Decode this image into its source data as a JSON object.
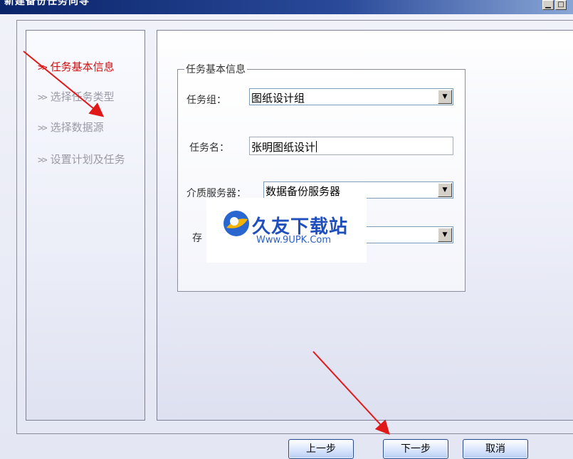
{
  "window": {
    "title": "新建备份任务向导",
    "minimize_symbol": "▁",
    "maximize_symbol": "□"
  },
  "steps": [
    {
      "chevron": ">>",
      "label": "任务基本信息",
      "active": true
    },
    {
      "chevron": ">>",
      "label": "选择任务类型",
      "active": false
    },
    {
      "chevron": ">>",
      "label": "选择数据源",
      "active": false
    },
    {
      "chevron": ">>",
      "label": "设置计划及任务",
      "active": false
    }
  ],
  "group": {
    "legend": "任务基本信息",
    "task_group": {
      "label": "任务组：",
      "value": "图纸设计组"
    },
    "task_name": {
      "label": "任务名：",
      "value": "张明图纸设计"
    },
    "media_server": {
      "label": "介质服务器：",
      "value": "数据备份服务器"
    },
    "storage": {
      "label": "存",
      "value": ""
    }
  },
  "buttons": {
    "prev": "上一步",
    "next": "下一步",
    "cancel": "取消"
  },
  "watermark": {
    "title": "久友下载站",
    "url": "Www.9UPK.Com"
  },
  "icons": {
    "dropdown": "chevron-down-icon",
    "annotation": "red-arrow-icon",
    "logo": "watermark-logo-icon"
  },
  "colors": {
    "active_step": "#d01010",
    "inactive_step": "#9a9aa6",
    "annotation_arrow": "#e01818",
    "title_bar": "#0a246a",
    "watermark_text": "#1f4fbd"
  }
}
